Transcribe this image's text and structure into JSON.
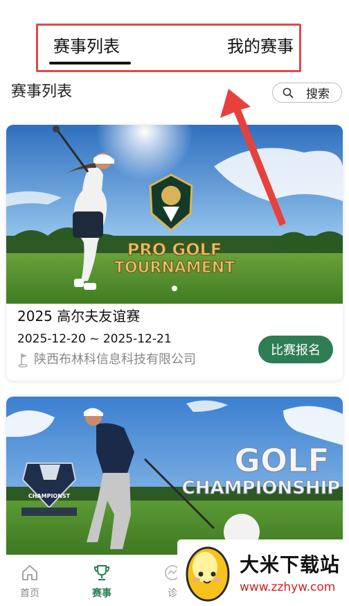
{
  "tabs": {
    "active": "赛事列表",
    "other": "我的赛事"
  },
  "section": {
    "title": "赛事列表",
    "search_label": "搜索"
  },
  "events": [
    {
      "title": "2025 高尔夫友谊赛",
      "date_range": "2025-12-20 ~ 2025-12-21",
      "organizer": "陕西布林科信息科技有限公司",
      "button_label": "比赛报名",
      "image_text_line1": "PRO GOLF",
      "image_text_line2": "TOURNAMENT"
    },
    {
      "image_text_line1": "GOLF",
      "image_text_line2": "CHAMPIONSHIP",
      "badge_text": "CHAMPIONST"
    }
  ],
  "bottom_nav": [
    {
      "label": "首页",
      "icon": "home-icon"
    },
    {
      "label": "赛事",
      "icon": "trophy-icon",
      "active": true
    },
    {
      "label": "诊",
      "icon": "chart-icon"
    }
  ],
  "watermark": {
    "title": "大米下载站",
    "url": "www.zzhyw.com"
  },
  "colors": {
    "accent_green": "#2e7d55",
    "highlight_red": "#e04848"
  }
}
